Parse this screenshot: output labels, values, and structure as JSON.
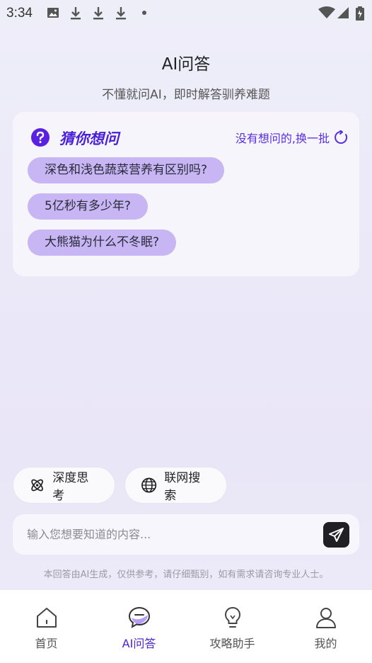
{
  "status_bar": {
    "time": "3:34"
  },
  "header": {
    "title": "AI问答",
    "subtitle": "不懂就问AI，即时解答驯养难题"
  },
  "suggest_card": {
    "title": "猜你想问",
    "refresh_label": "没有想问的,换一批",
    "questions": [
      "深色和浅色蔬菜营养有区别吗?",
      "5亿秒有多少年?",
      "大熊猫为什么不冬眠?"
    ]
  },
  "modes": {
    "deep_think": "深度思考",
    "web_search": "联网搜索"
  },
  "input": {
    "placeholder": "输入您想要知道的内容..."
  },
  "disclaimer": "本回答由AI生成，仅供参考，请仔细甄别，如有需求请咨询专业人士。",
  "tabbar": {
    "items": [
      {
        "label": "首页",
        "icon": "home-icon"
      },
      {
        "label": "AI问答",
        "icon": "chat-bubble-icon"
      },
      {
        "label": "攻略助手",
        "icon": "lightbulb-icon"
      },
      {
        "label": "我的",
        "icon": "user-icon"
      }
    ],
    "active_index": 1
  },
  "colors": {
    "accent": "#4a1fd8",
    "chip": "#c7b6f3"
  }
}
